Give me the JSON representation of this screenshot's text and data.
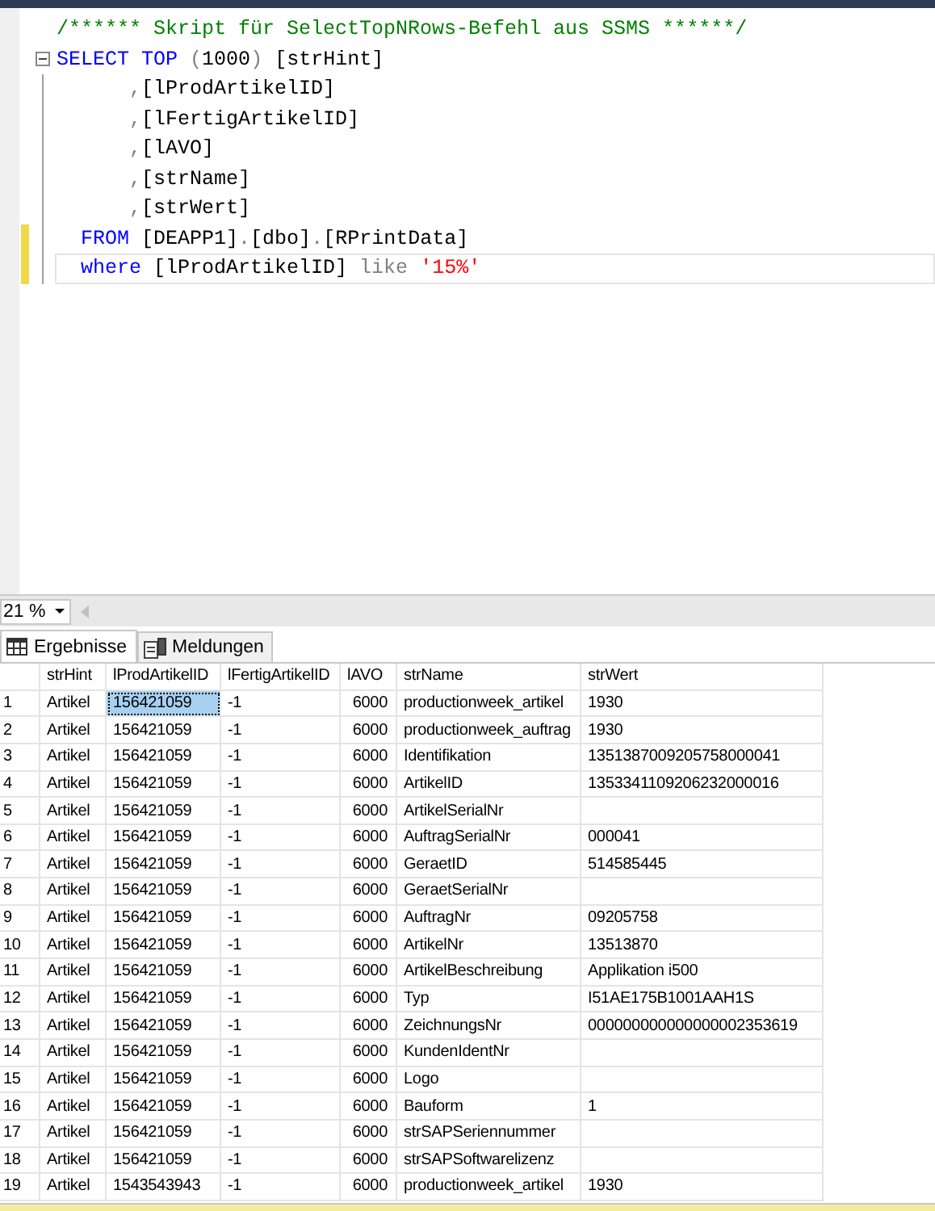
{
  "editor": {
    "lines": [
      {
        "kind": "comment",
        "changed": false,
        "current": false,
        "tokens": [
          {
            "kind": "comment",
            "text": "/****** Skript für SelectTopNRows-Befehl aus SSMS ******/"
          }
        ]
      },
      {
        "kind": "statement",
        "changed": false,
        "current": false,
        "tokens": [
          {
            "kind": "keyword",
            "text": "SELECT"
          },
          {
            "kind": "keyword",
            "text": " TOP"
          },
          {
            "kind": "operator",
            "text": " ("
          },
          {
            "kind": "text",
            "text": "1000"
          },
          {
            "kind": "operator",
            "text": ")"
          },
          {
            "kind": "text",
            "text": " [strHint]"
          }
        ]
      },
      {
        "kind": "continuation",
        "changed": false,
        "current": false,
        "tokens": [
          {
            "kind": "operator",
            "text": "      ,"
          },
          {
            "kind": "text",
            "text": "[lProdArtikelID]"
          }
        ]
      },
      {
        "kind": "continuation",
        "changed": false,
        "current": false,
        "tokens": [
          {
            "kind": "operator",
            "text": "      ,"
          },
          {
            "kind": "text",
            "text": "[lFertigArtikelID]"
          }
        ]
      },
      {
        "kind": "continuation",
        "changed": false,
        "current": false,
        "tokens": [
          {
            "kind": "operator",
            "text": "      ,"
          },
          {
            "kind": "text",
            "text": "[lAVO]"
          }
        ]
      },
      {
        "kind": "continuation",
        "changed": false,
        "current": false,
        "tokens": [
          {
            "kind": "operator",
            "text": "      ,"
          },
          {
            "kind": "text",
            "text": "[strName]"
          }
        ]
      },
      {
        "kind": "continuation",
        "changed": false,
        "current": false,
        "tokens": [
          {
            "kind": "operator",
            "text": "      ,"
          },
          {
            "kind": "text",
            "text": "[strWert]"
          }
        ]
      },
      {
        "kind": "continuation",
        "changed": true,
        "current": false,
        "tokens": [
          {
            "kind": "keyword",
            "text": "  FROM"
          },
          {
            "kind": "text",
            "text": " [DEAPP1]"
          },
          {
            "kind": "operator",
            "text": "."
          },
          {
            "kind": "text",
            "text": "[dbo]"
          },
          {
            "kind": "operator",
            "text": "."
          },
          {
            "kind": "text",
            "text": "[RPrintData]"
          }
        ]
      },
      {
        "kind": "continuation",
        "changed": true,
        "current": true,
        "tokens": [
          {
            "kind": "keyword",
            "text": "  where"
          },
          {
            "kind": "text",
            "text": " [lProdArtikelID] "
          },
          {
            "kind": "operator",
            "text": "like"
          },
          {
            "kind": "string",
            "text": " '15%'"
          }
        ]
      }
    ]
  },
  "zoom": {
    "value": "21 %"
  },
  "tabs": [
    {
      "label": "Ergebnisse",
      "kind": "grid",
      "selected": true
    },
    {
      "label": "Meldungen",
      "kind": "messages",
      "selected": false
    }
  ],
  "table": {
    "columns": [
      {
        "label": "strHint",
        "focused": false
      },
      {
        "label": "lProdArtikelID",
        "focused": true
      },
      {
        "label": "lFertigArtikelID",
        "focused": false
      },
      {
        "label": "lAVO",
        "focused": false
      },
      {
        "label": "strName",
        "focused": false
      },
      {
        "label": "strWert",
        "focused": false
      }
    ],
    "rows": [
      {
        "number": "1",
        "selected": true,
        "cells": [
          "Artikel",
          "156421059",
          "-1",
          "6000",
          "productionweek_artikel",
          "1930"
        ]
      },
      {
        "number": "2",
        "selected": false,
        "cells": [
          "Artikel",
          "156421059",
          "-1",
          "6000",
          "productionweek_auftrag",
          "1930"
        ]
      },
      {
        "number": "3",
        "selected": false,
        "cells": [
          "Artikel",
          "156421059",
          "-1",
          "6000",
          "Identifikation",
          "1351387009205758000041"
        ]
      },
      {
        "number": "4",
        "selected": false,
        "cells": [
          "Artikel",
          "156421059",
          "-1",
          "6000",
          "ArtikelID",
          "1353341109206232000016"
        ]
      },
      {
        "number": "5",
        "selected": false,
        "cells": [
          "Artikel",
          "156421059",
          "-1",
          "6000",
          "ArtikelSerialNr",
          ""
        ]
      },
      {
        "number": "6",
        "selected": false,
        "cells": [
          "Artikel",
          "156421059",
          "-1",
          "6000",
          "AuftragSerialNr",
          "000041"
        ]
      },
      {
        "number": "7",
        "selected": false,
        "cells": [
          "Artikel",
          "156421059",
          "-1",
          "6000",
          "GeraetID",
          "514585445"
        ]
      },
      {
        "number": "8",
        "selected": false,
        "cells": [
          "Artikel",
          "156421059",
          "-1",
          "6000",
          "GeraetSerialNr",
          ""
        ]
      },
      {
        "number": "9",
        "selected": false,
        "cells": [
          "Artikel",
          "156421059",
          "-1",
          "6000",
          "AuftragNr",
          "09205758"
        ]
      },
      {
        "number": "10",
        "selected": false,
        "cells": [
          "Artikel",
          "156421059",
          "-1",
          "6000",
          "ArtikelNr",
          "13513870"
        ]
      },
      {
        "number": "11",
        "selected": false,
        "cells": [
          "Artikel",
          "156421059",
          "-1",
          "6000",
          "ArtikelBeschreibung",
          "Applikation i500"
        ]
      },
      {
        "number": "12",
        "selected": false,
        "cells": [
          "Artikel",
          "156421059",
          "-1",
          "6000",
          "Typ",
          "I51AE175B1001AAH1S"
        ]
      },
      {
        "number": "13",
        "selected": false,
        "cells": [
          "Artikel",
          "156421059",
          "-1",
          "6000",
          "ZeichnungsNr",
          "000000000000000002353619"
        ]
      },
      {
        "number": "14",
        "selected": false,
        "cells": [
          "Artikel",
          "156421059",
          "-1",
          "6000",
          "KundenIdentNr",
          ""
        ]
      },
      {
        "number": "15",
        "selected": false,
        "cells": [
          "Artikel",
          "156421059",
          "-1",
          "6000",
          "Logo",
          ""
        ]
      },
      {
        "number": "16",
        "selected": false,
        "cells": [
          "Artikel",
          "156421059",
          "-1",
          "6000",
          "Bauform",
          "1"
        ]
      },
      {
        "number": "17",
        "selected": false,
        "cells": [
          "Artikel",
          "156421059",
          "-1",
          "6000",
          "strSAPSeriennummer",
          ""
        ]
      },
      {
        "number": "18",
        "selected": false,
        "cells": [
          "Artikel",
          "156421059",
          "-1",
          "6000",
          "strSAPSoftwarelizenz",
          ""
        ]
      },
      {
        "number": "19",
        "selected": false,
        "cells": [
          "Artikel",
          "1543543943",
          "-1",
          "6000",
          "productionweek_artikel",
          "1930"
        ]
      }
    ]
  }
}
